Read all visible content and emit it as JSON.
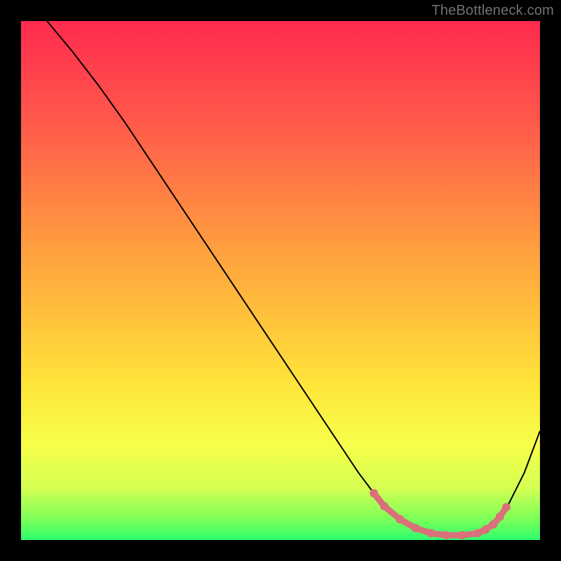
{
  "watermark": "TheBottleneck.com",
  "chart_data": {
    "type": "line",
    "title": "",
    "xlabel": "",
    "ylabel": "",
    "xlim": [
      0,
      100
    ],
    "ylim": [
      0,
      100
    ],
    "grid": false,
    "legend": false,
    "gradient_stops": [
      {
        "offset": 0.0,
        "color": "#ff2b4f"
      },
      {
        "offset": 0.2,
        "color": "#ff5a4a"
      },
      {
        "offset": 0.45,
        "color": "#ffa23e"
      },
      {
        "offset": 0.7,
        "color": "#ffe43a"
      },
      {
        "offset": 0.82,
        "color": "#f6ff4a"
      },
      {
        "offset": 0.9,
        "color": "#d4ff52"
      },
      {
        "offset": 0.96,
        "color": "#7cff58"
      },
      {
        "offset": 1.0,
        "color": "#2dff6e"
      }
    ],
    "series": [
      {
        "name": "bottleneck-curve",
        "color": "#000000",
        "x": [
          5,
          10,
          15,
          20,
          25,
          30,
          35,
          40,
          45,
          50,
          55,
          60,
          62,
          65,
          68,
          70,
          73,
          76,
          79,
          82,
          85,
          88,
          91,
          94,
          97,
          100
        ],
        "y": [
          100,
          94,
          87.5,
          80.5,
          73,
          65.5,
          58,
          50.5,
          43,
          35.5,
          28,
          20.5,
          17.5,
          13,
          9,
          6.5,
          4,
          2.3,
          1.3,
          0.9,
          0.9,
          1.3,
          3,
          7,
          13,
          21
        ]
      }
    ],
    "highlight": {
      "name": "optimal-range",
      "color": "#d9707a",
      "points": [
        {
          "x": 68,
          "y": 9
        },
        {
          "x": 70,
          "y": 6.5
        },
        {
          "x": 73,
          "y": 4
        },
        {
          "x": 76,
          "y": 2.3
        },
        {
          "x": 79,
          "y": 1.3
        },
        {
          "x": 82,
          "y": 0.9
        },
        {
          "x": 85,
          "y": 0.9
        },
        {
          "x": 88,
          "y": 1.3
        },
        {
          "x": 89.5,
          "y": 2
        },
        {
          "x": 91,
          "y": 3
        },
        {
          "x": 92.3,
          "y": 4.5
        },
        {
          "x": 93.5,
          "y": 6.3
        }
      ]
    }
  }
}
